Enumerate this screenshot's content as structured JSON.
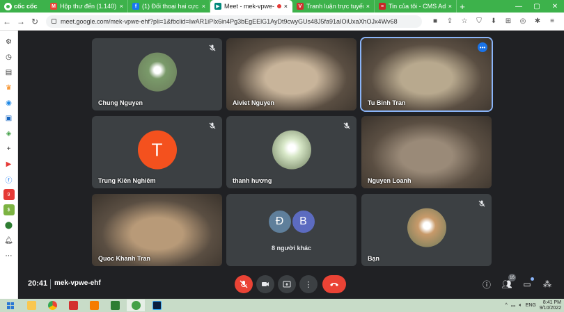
{
  "browser": {
    "brand": "cốc cốc",
    "tabs": [
      {
        "title": "Hộp thư đến (1.140)",
        "icon": "gmail-icon",
        "color": "#ea4335",
        "glyph": "M",
        "active": false
      },
      {
        "title": "(1) Đối thoại hai cực v",
        "icon": "facebook-icon",
        "color": "#1877f2",
        "glyph": "f",
        "active": false
      },
      {
        "title": "Meet - mek-vpwe-",
        "icon": "meet-icon",
        "color": "#00897b",
        "glyph": "▶",
        "active": true
      },
      {
        "title": "Tranh luận trực tuyến",
        "icon": "v-icon",
        "color": "#d32f2f",
        "glyph": "V",
        "active": false
      },
      {
        "title": "Tin của tôi - CMS Adm",
        "icon": "cms-icon",
        "color": "#c62828",
        "glyph": "≡",
        "active": false
      }
    ],
    "url": "meet.google.com/mek-vpwe-ehf?pli=1&fbclid=IwAR1iPIx6in4Pg3bEgEElG1AyDt9cwyGUs48J5fa91aIOiUxaXhOJx4Wv68"
  },
  "meet": {
    "participants": [
      {
        "name": "Chung Nguyen",
        "muted": true,
        "kind": "photo-avatar",
        "color": "#7a9a6a"
      },
      {
        "name": "Aiviet Nguyen",
        "muted": false,
        "kind": "video",
        "color": "#c8b49a"
      },
      {
        "name": "Tu Binh Tran",
        "muted": false,
        "kind": "video",
        "color": "#b8a98e",
        "active": true
      },
      {
        "name": "Trung Kiên Nghiêm",
        "muted": true,
        "kind": "letter",
        "letter": "T",
        "color": "#f4511e"
      },
      {
        "name": "thanh hương",
        "muted": true,
        "kind": "photo-avatar",
        "color": "#d8e8c8"
      },
      {
        "name": "Nguyen Loanh",
        "muted": false,
        "kind": "video",
        "color": "#9a8a78"
      },
      {
        "name": "Quoc Khanh Tran",
        "muted": false,
        "kind": "video",
        "color": "#b89a78"
      },
      {
        "name": "8 người khác",
        "muted": false,
        "kind": "others",
        "letters": [
          "Đ",
          "B"
        ],
        "colors": [
          "#5f7f9b",
          "#5c6bc0"
        ]
      },
      {
        "name": "Bạn",
        "muted": true,
        "kind": "photo-avatar",
        "color": "#c89a6a"
      }
    ],
    "clock": "20:41",
    "meeting_code": "mek-vpwe-ehf",
    "people_count": "16"
  },
  "taskbar": {
    "lang": "ENG",
    "time": "8:41 PM",
    "date": "9/10/2022"
  }
}
